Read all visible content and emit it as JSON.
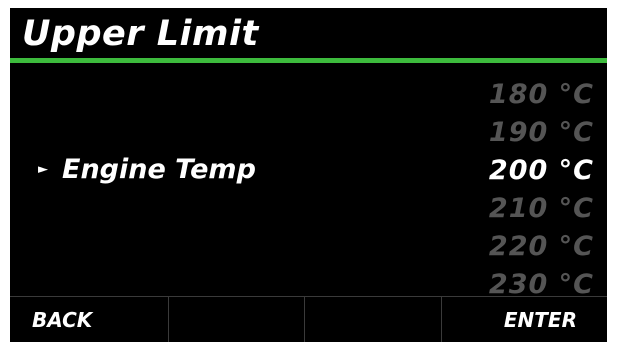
{
  "header": {
    "title": "Upper Limit"
  },
  "colors": {
    "accent": "#3dbb3d",
    "background": "#000000",
    "text": "#ffffff",
    "dim_text": "#555555"
  },
  "parameter": {
    "indicator_icon": "triangle-right-icon",
    "indicator_glyph": "►",
    "label": "Engine Temp"
  },
  "value_list": {
    "selected_index": 2,
    "items": [
      "180 °C",
      "190 °C",
      "200 °C",
      "210 °C",
      "220 °C",
      "230 °C"
    ]
  },
  "softkeys": [
    {
      "label": "BACK"
    },
    {
      "label": ""
    },
    {
      "label": ""
    },
    {
      "label": "ENTER"
    }
  ]
}
